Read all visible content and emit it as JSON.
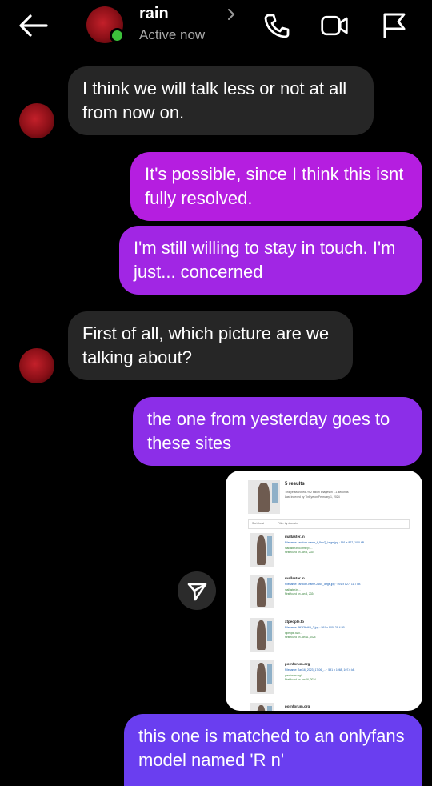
{
  "header": {
    "name": "rain",
    "status": "Active now"
  },
  "colors": {
    "incoming_bubble": "#262626",
    "outgoing_top": "#b51ee0",
    "outgoing_mid": "#8c2ee8",
    "outgoing_bottom": "#6a3ef0",
    "online": "#3cc13b"
  },
  "messages": [
    {
      "direction": "in",
      "text": "I think we will talk less or not at all from now on."
    },
    {
      "direction": "out",
      "text": "It's possible, since I think this isnt fully resolved."
    },
    {
      "direction": "out",
      "text": "I'm still willing to stay in touch. I'm just... concerned"
    },
    {
      "direction": "in",
      "text": "First of all, which picture are we talking about?"
    },
    {
      "direction": "out",
      "text": "the one from yesterday goes to these sites"
    },
    {
      "direction": "out",
      "text": "this one is matched to an onlyfans model named 'R       n'"
    }
  ],
  "screenshot": {
    "count": "5 results",
    "meta1": "TinEye searched 79.2 billion images in 1.1 seconds",
    "meta2": "Last indexed by TinEye on February 1, 2024",
    "filter1": "Sort: best",
    "filter2": "Filter by domain",
    "results": [
      {
        "site": "mallaster.in",
        "file": "Filename: random-name_f_8ncQ_large.jpg · 591 x 827, 10.0 kB",
        "url": "mallaster.in/lo.html?p=...",
        "url2": "First found on Jan 5, 2024"
      },
      {
        "site": "mallaster.in",
        "file": "Filename: random-name-2665_large.jpg · 591 x 827, 11.7 kB",
        "url": "mallaster.in/...",
        "url2": "First found on Jan 5, 2024"
      },
      {
        "site": "xtpeople.to",
        "file": "Filename: 5ff1f3bd6d_3.jpg · 591 x 800, 29.4 kB",
        "url": "xtpeople.to/p/...",
        "url2": "First found on Jan 11, 2024"
      },
      {
        "site": "pornforum.org",
        "file": "Filename: Jan16_2023_17.06_... · 591 x 1068, 107.6 kB",
        "url": "pornforum.org/...",
        "url2": "First found on Jan 16, 2024"
      },
      {
        "site": "pornforum.org",
        "file": "",
        "url": "",
        "url2": ""
      }
    ]
  }
}
